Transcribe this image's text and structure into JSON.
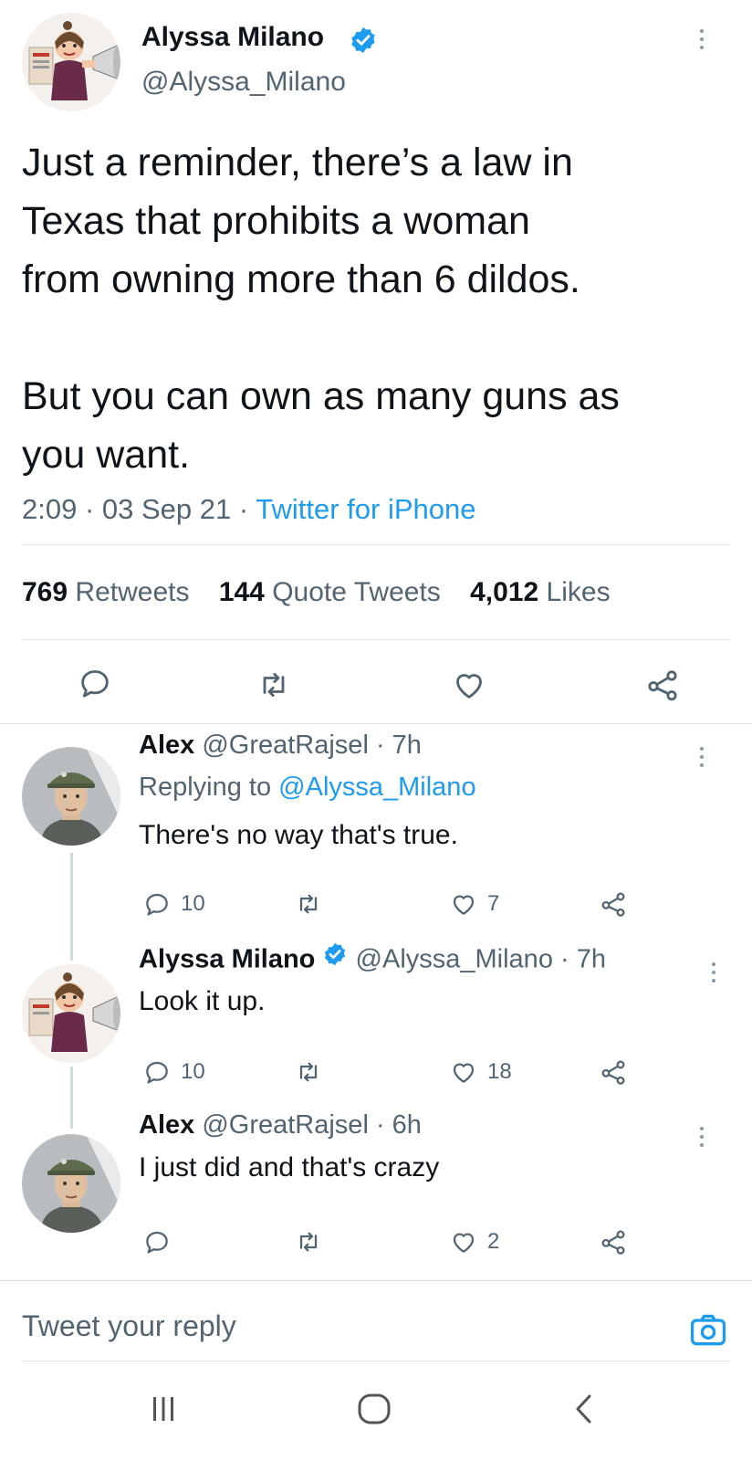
{
  "main_tweet": {
    "author_name": "Alyssa Milano",
    "author_handle": "@Alyssa_Milano",
    "text_lines": [
      "Just a reminder, there’s a law in",
      "Texas that prohibits a woman",
      "from owning more than 6 dildos.",
      "But you can own as many guns as",
      "you want."
    ],
    "time": "2:09",
    "date": "03 Sep 21",
    "source": "Twitter for iPhone",
    "retweets_count": "769",
    "retweets_label": "Retweets",
    "quotes_count": "144",
    "quotes_label": "Quote Tweets",
    "likes_count": "4,012",
    "likes_label": "Likes"
  },
  "replies": [
    {
      "name": "Alex",
      "handle": "@GreatRajsel",
      "time": "7h",
      "replying_prefix": "Replying to",
      "replying_to": "@Alyssa_Milano",
      "text": "There's no way that's true.",
      "reply_count": "10",
      "retweet_count": "",
      "like_count": "7"
    },
    {
      "name": "Alyssa Milano",
      "handle": "@Alyssa_Milano",
      "time": "7h",
      "text": "Look it up.",
      "reply_count": "10",
      "retweet_count": "",
      "like_count": "18"
    },
    {
      "name": "Alex",
      "handle": "@GreatRajsel",
      "time": "6h",
      "text": "I just did and that's crazy",
      "reply_count": "",
      "retweet_count": "",
      "like_count": "2"
    }
  ],
  "composer": {
    "placeholder": "Tweet your reply"
  },
  "colors": {
    "accent": "#1d9bf0",
    "text": "#0f1419",
    "secondary": "#536471",
    "divider": "#e1e4e6"
  },
  "icons": [
    "verified-badge-icon",
    "more-options-icon",
    "reply-icon",
    "retweet-icon",
    "like-icon",
    "share-icon",
    "camera-icon",
    "recent-apps-icon",
    "home-icon",
    "back-icon"
  ]
}
